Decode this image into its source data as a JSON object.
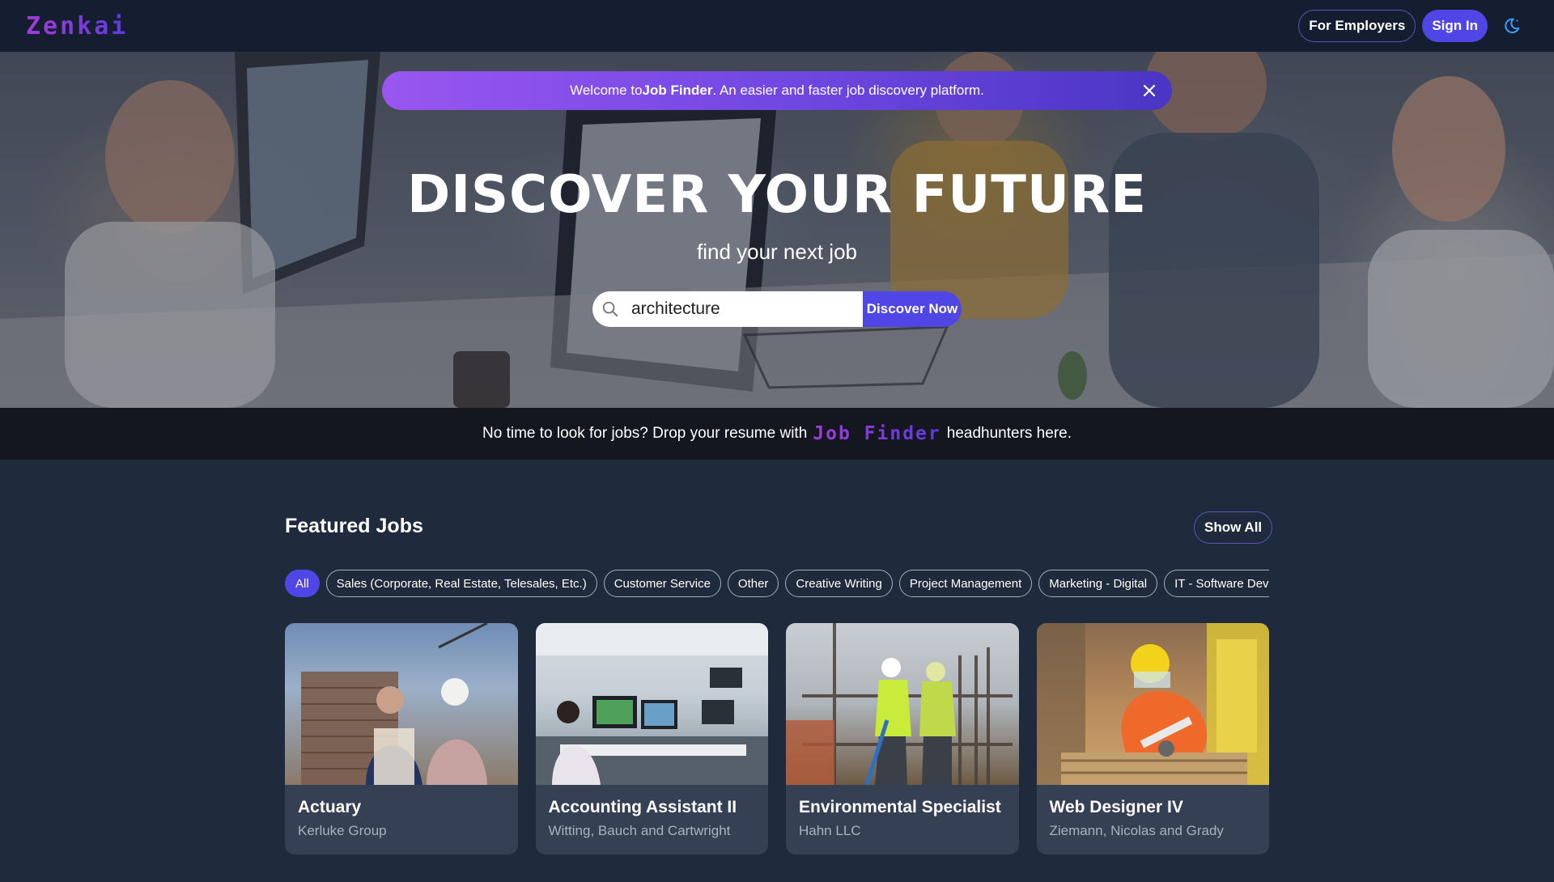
{
  "header": {
    "logo": "Zenkai",
    "employers_label": "For Employers",
    "signin_label": "Sign In",
    "theme_icon": "moon-icon"
  },
  "banner": {
    "prefix": "Welcome to ",
    "brand": "Job Finder",
    "suffix": ". An easier and faster job discovery platform."
  },
  "hero": {
    "title": "DISCOVER YOUR FUTURE",
    "subtitle": "find your next job",
    "search_value": "architecture",
    "discover_label": "Discover Now"
  },
  "resume": {
    "prefix": "No time to look for jobs? Drop your resume with",
    "brand": "Job Finder",
    "suffix": "headhunters here."
  },
  "featured": {
    "title": "Featured Jobs",
    "show_all_label": "Show All",
    "chips": [
      "All",
      "Sales (Corporate, Real Estate, Telesales, Etc.)",
      "Customer Service",
      "Other",
      "Creative Writing",
      "Project Management",
      "Marketing - Digital",
      "IT - Software Development"
    ],
    "jobs": [
      {
        "title": "Actuary",
        "company": "Kerluke Group"
      },
      {
        "title": "Accounting Assistant II",
        "company": "Witting, Bauch and Cartwright"
      },
      {
        "title": "Environmental Specialist",
        "company": "Hahn LLC"
      },
      {
        "title": "Web Designer IV",
        "company": "Ziemann, Nicolas and Grady"
      }
    ]
  },
  "colors": {
    "accent": "#4f46e5",
    "nav_bg": "#151d30",
    "page_bg": "#1f2a3d",
    "card_bg": "#364055"
  }
}
